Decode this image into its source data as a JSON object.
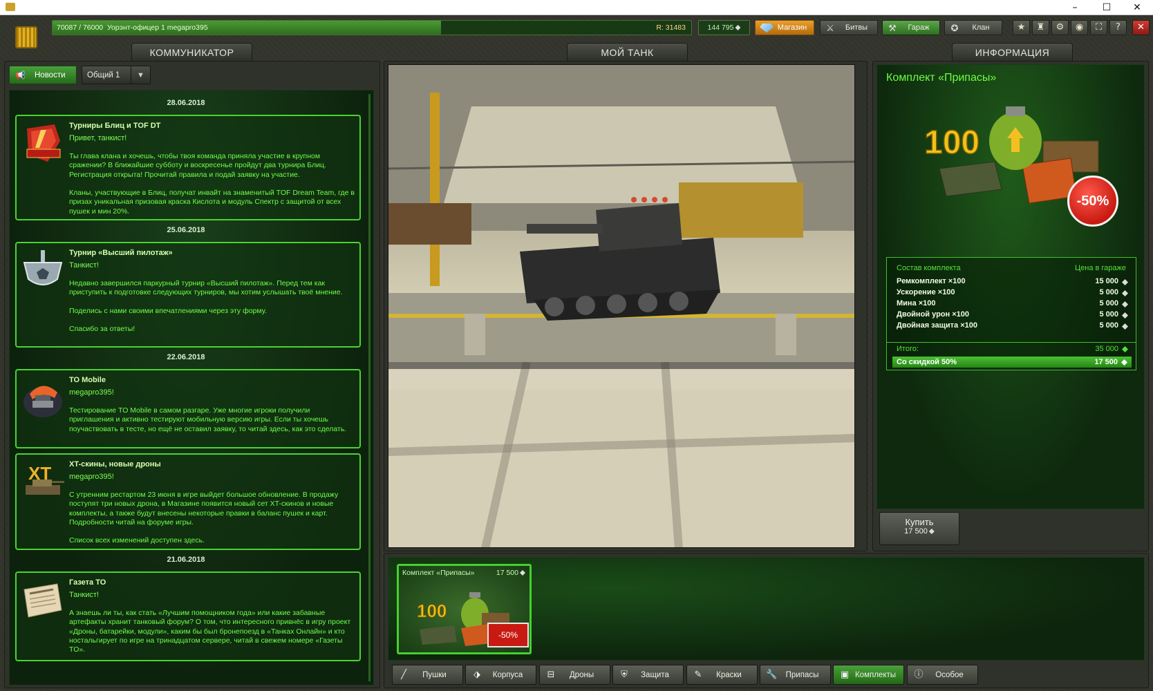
{
  "topbar": {
    "progress": "70087 / 76000",
    "rank_text": "Уорэнт-офицер 1 megapro395",
    "rating": "R: 31483",
    "progress_fraction": 0.922,
    "crystals": "144 795",
    "shop": "Магазин",
    "nav": [
      {
        "label": "Битвы",
        "icon": "crossed-swords-icon"
      },
      {
        "label": "Гараж",
        "icon": "tools-icon"
      },
      {
        "label": "Клан",
        "icon": "medal-icon"
      }
    ]
  },
  "tabs": {
    "communicator": "КОММУНИКАТОР",
    "my_tank": "МОЙ ТАНК",
    "info": "ИНФОРМАЦИЯ"
  },
  "communicator": {
    "news_button": "Новости",
    "channel": "Общий 1",
    "items": [
      {
        "date": "28.06.2018",
        "title": "Турниры Блиц и TOF DT",
        "greet": "Привет, танкист!",
        "body": "Ты глава клана и хочешь, чтобы твоя команда приняла участие в крупном сражении? В ближайшие субботу и воскресенье пройдут два турнира Блиц. Регистрация открыта! Прочитай правила и подай заявку на участие.\n\nКланы, участвующие в Блиц, получат инвайт на знаменитый TOF Dream Team, где в призах уникальная призовая краска Кислота и модуль Спектр с защитой от всех пушек и мин 20%."
      },
      {
        "date": "25.06.2018",
        "title": "Турнир «Высший пилотаж»",
        "greet": "Танкист!",
        "body": "Недавно завершился паркурный турнир «Высший пилотаж». Перед тем как приступить к подготовке следующих турниров, мы хотим услышать твоё мнение.\n\nПоделись с нами своими впечатлениями через эту форму.\n\nСпасибо за ответы!"
      },
      {
        "date": "22.06.2018",
        "title": "TO Mobile",
        "greet": "megapro395!",
        "body": "Тестирование TO Mobile в самом разгаре. Уже многие игроки получили приглашения и активно тестируют мобильную версию игры. Если ты хочешь поучаствовать в тесте, но ещё не оставил заявку, то читай здесь, как это сделать."
      },
      {
        "date": "",
        "title": "XT-скины, новые дроны",
        "greet": "megapro395!",
        "body": "С утренним рестартом 23 июня в игре выйдет большое обновление. В продажу поступят три новых дрона, в  Магазине появится новый сет XT-скинов и новые комплекты, а также будут внесены некоторые правки в баланс пушек и карт. Подробности читай на  форуме игры.\n\nСписок всех изменений доступен  здесь."
      },
      {
        "date": "21.06.2018",
        "title": "Газета TO",
        "greet": "Танкист!",
        "body": "А знаешь ли ты, как стать «Лучшим помощником года» или какие забавные артефакты хранит танковый форум? О том, что интересного привнёс в игру проект «Дроны, батарейки, модули», каким бы был бронепоезд в «Танках Онлайн» и кто ностальгирует по игре на тринадцатом сервере, читай в свежем номере «Газеты TO»."
      }
    ]
  },
  "info": {
    "title": "Комплект «Припасы»",
    "kit_number": "100",
    "discount_badge": "-50%",
    "kit_header_left": "Состав комплекта",
    "kit_header_right": "Цена в гараже",
    "rows": [
      {
        "name": "Ремкомплект ×100",
        "price": "15 000"
      },
      {
        "name": "Ускорение ×100",
        "price": "5 000"
      },
      {
        "name": "Мина ×100",
        "price": "5 000"
      },
      {
        "name": "Двойной урон ×100",
        "price": "5 000"
      },
      {
        "name": "Двойная защита ×100",
        "price": "5 000"
      }
    ],
    "total_label": "Итого:",
    "total_price": "35 000",
    "discount_label": "Со скидкой 50%",
    "discount_price": "17 500",
    "buy_label": "Купить",
    "buy_price": "17 500"
  },
  "item_card": {
    "name": "Комплект «Припасы»",
    "price": "17 500",
    "number": "100",
    "badge": "-50%"
  },
  "categories": [
    {
      "label": "Пушки",
      "icon": "gun-icon"
    },
    {
      "label": "Корпуса",
      "icon": "hull-icon"
    },
    {
      "label": "Дроны",
      "icon": "drone-icon"
    },
    {
      "label": "Защита",
      "icon": "shield-icon"
    },
    {
      "label": "Краски",
      "icon": "brush-icon"
    },
    {
      "label": "Припасы",
      "icon": "wrench-icon"
    },
    {
      "label": "Комплекты",
      "icon": "kit-icon",
      "active": true
    },
    {
      "label": "Особое",
      "icon": "exclamation-icon"
    }
  ],
  "colors": {
    "accent_green": "#4ad432",
    "news_text": "#6fff4a",
    "discount_red": "#c81a12"
  }
}
